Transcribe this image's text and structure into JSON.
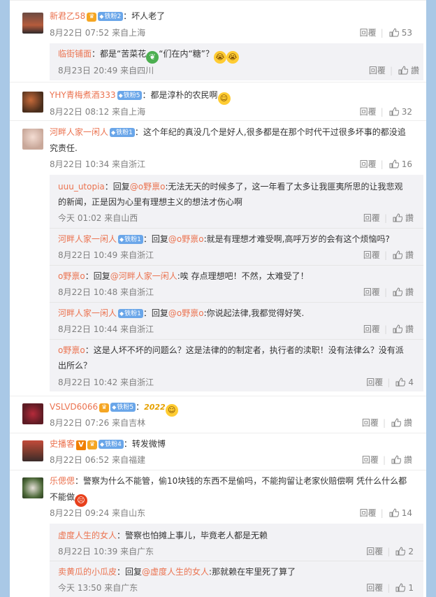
{
  "comments": [
    {
      "name": "新君乙58",
      "badge": "铁粉2",
      "text": "：坏人老了",
      "meta": "8月22日 07:52 来自上海",
      "reply": "回覆",
      "likes": "53",
      "replies": [
        {
          "name": "临街铺面",
          "text": "：都是“苦菜花",
          "text2": "“们在内“糖”？",
          "meta": "8月23日 20:49 来自四川",
          "reply": "回覆",
          "likes": "讚"
        }
      ]
    },
    {
      "name": "YHY青梅煮酒333",
      "badge": "铁粉5",
      "text": "：都是淳朴的农民啊",
      "meta": "8月22日 08:12 来自上海",
      "reply": "回覆",
      "likes": "32"
    },
    {
      "name": "河畔人家一闲人",
      "badge": "铁粉1",
      "text": "：这个年纪的真没几个是好人,很多都是在那个时代干过很多坏事的都没追",
      "text_cont": "究责任.",
      "meta": "8月22日 10:34 来自浙江",
      "reply": "回覆",
      "likes": "16",
      "replies": [
        {
          "name": "uuu_utopia",
          "prefix": "：回复",
          "at": "@o野禀o",
          "text": ":无法无天的时候多了，这一年看了太多让我匪夷所思的让我悲观",
          "text_cont": "的新闻，正是因为心里有理想主义的想法才伤心啊",
          "meta": "今天 01:02 来自山西",
          "reply": "回覆",
          "likes": "讚"
        },
        {
          "name": "河畔人家一闲人",
          "badge": "铁粉1",
          "prefix": "：回复",
          "at": "@o野禀o",
          "text": ":就是有理想才难受啊,高呼万岁的会有这个烦恼吗?",
          "meta": "8月22日 10:49 来自浙江",
          "reply": "回覆",
          "likes": "讚"
        },
        {
          "name": "o野禀o",
          "prefix": "：回复",
          "at": "@河畔人家一闲人",
          "text": ":唉 存点理想吧！不然，太难受了！",
          "meta": "8月22日 10:48 来自浙江",
          "reply": "回覆",
          "likes": "讚"
        },
        {
          "name": "河畔人家一闲人",
          "badge": "铁粉1",
          "prefix": "：回复",
          "at": "@o野禀o",
          "text": ":你说起法律,我都觉得好笑.",
          "meta": "8月22日 10:44 来自浙江",
          "reply": "回覆",
          "likes": "讚"
        },
        {
          "name": "o野禀o",
          "text": "：这是人坏不坏的问题么？这是法律的的制定者，执行者的渎职！没有法律么？没有派",
          "text_cont": "出所么？",
          "meta": "8月22日 10:42 来自浙江",
          "reply": "回覆",
          "likes": "4"
        }
      ]
    },
    {
      "name": "VSLVD6066",
      "badge": "铁粉5",
      "text": "：",
      "tag": "2022",
      "meta": "8月22日 07:26 来自吉林",
      "reply": "回覆",
      "likes": "讚"
    },
    {
      "name": "史播客",
      "vip": "V",
      "badge": "铁粉4",
      "text": "：转发微博",
      "meta": "8月22日 06:52 来自福建",
      "reply": "回覆",
      "likes": "讚"
    },
    {
      "name": "乐偲偲",
      "text": "：警察为什么不能管，偷10块钱的东西不是偷吗，不能拘留让老家伙赔偿啊 凭什么什么都",
      "text_cont": "不能做",
      "meta": "8月22日 09:24 来自山东",
      "reply": "回覆",
      "likes": "14",
      "replies": [
        {
          "name": "虚度人生的女人",
          "text": "：警察也怕摊上事儿，毕竟老人都是无赖",
          "meta": "8月22日 10:39 来自广东",
          "reply": "回覆",
          "likes": "2"
        },
        {
          "name": "卖黄瓜的小瓜皮",
          "prefix": "：回复",
          "at": "@虚度人生的女人",
          "text": ":那就赖在牢里死了算了",
          "meta": "今天 13:50 来自广东",
          "reply": "回覆",
          "likes": "1"
        }
      ]
    }
  ],
  "icons": {
    "thumb": "thumb-up-icon",
    "badge": "fan-badge-icon"
  }
}
